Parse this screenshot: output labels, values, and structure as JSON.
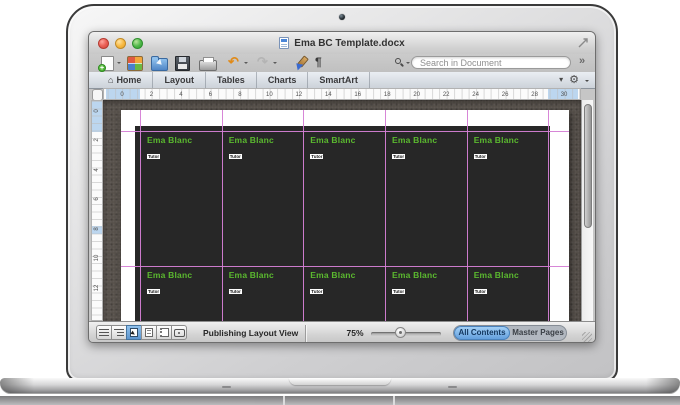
{
  "window": {
    "title": "Ema BC Template.docx"
  },
  "toolbar": {
    "icons": [
      "new-document",
      "elements-gallery",
      "open",
      "save",
      "print",
      "undo",
      "redo",
      "format-painter",
      "show-formatting-marks"
    ],
    "pilcrow": "¶",
    "search": {
      "placeholder": "Search in Document"
    },
    "more": "»"
  },
  "ribbon": {
    "tabs": [
      {
        "label": "Home",
        "icon": "⌂"
      },
      {
        "label": "Layout"
      },
      {
        "label": "Tables"
      },
      {
        "label": "Charts"
      },
      {
        "label": "SmartArt"
      }
    ]
  },
  "ruler": {
    "horizontal": [
      "0",
      "2",
      "4",
      "6",
      "8",
      "10",
      "12",
      "14",
      "16",
      "18",
      "20",
      "22",
      "24",
      "26",
      "28",
      "30"
    ],
    "vertical": [
      "0",
      "2",
      "4",
      "6",
      "8",
      "10",
      "12"
    ]
  },
  "document": {
    "grid": {
      "rows": 2,
      "cols": 5
    },
    "card": {
      "name": "Ema Blanc",
      "subtitle": "Tutor"
    },
    "colors": {
      "card_bg": "#272727",
      "name_green": "#5bb92f",
      "guide_pink": "#d57fd5",
      "desk_bg": "#56504a"
    }
  },
  "statusbar": {
    "view_buttons": [
      "draft-view",
      "outline-view",
      "publishing-layout-view",
      "print-layout-view",
      "notebook-layout-view",
      "focus-view"
    ],
    "active_view_index": 2,
    "view_label": "Publishing Layout View",
    "zoom_label": "75%",
    "tabs": [
      {
        "label": "All Contents",
        "active": true
      },
      {
        "label": "Master Pages",
        "active": false
      }
    ]
  }
}
